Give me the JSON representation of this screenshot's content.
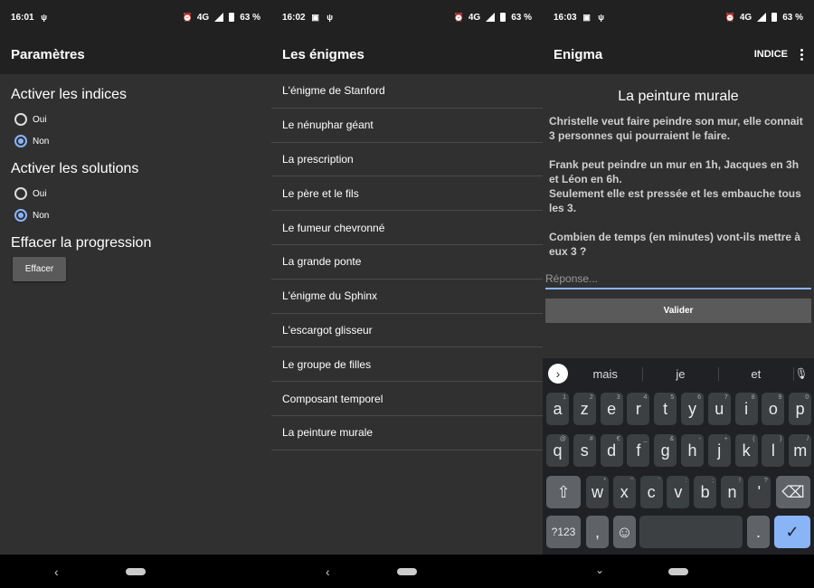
{
  "screens": [
    {
      "status": {
        "time": "16:01",
        "battery": "63 %",
        "network": "4G"
      },
      "appbar_title": "Paramètres",
      "hints": {
        "title": "Activer les indices",
        "yes": "Oui",
        "no": "Non",
        "selected": "Non"
      },
      "solutions": {
        "title": "Activer les solutions",
        "yes": "Oui",
        "no": "Non",
        "selected": "Non"
      },
      "reset": {
        "title": "Effacer la progression",
        "button": "Effacer"
      }
    },
    {
      "status": {
        "time": "16:02",
        "battery": "63 %",
        "network": "4G"
      },
      "appbar_title": "Les énigmes",
      "riddles": [
        "L'énigme de Stanford",
        "Le nénuphar géant",
        "La prescription",
        "Le père et le fils",
        "Le fumeur chevronné",
        "La grande ponte",
        "L'énigme du Sphinx",
        "L'escargot glisseur",
        "Le groupe de filles",
        "Composant temporel",
        "La peinture murale"
      ]
    },
    {
      "status": {
        "time": "16:03",
        "battery": "63 %",
        "network": "4G"
      },
      "appbar_title": "Enigma",
      "hint_action": "INDICE",
      "puzzle_title": "La peinture murale",
      "paragraphs": [
        "Christelle veut faire peindre son mur, elle connait 3 personnes qui pourraient le faire.",
        "Frank peut peindre un mur en 1h, Jacques en 3h et Léon en 6h.\nSeulement elle est pressée et les embauche tous les 3.",
        "Combien de temps (en minutes) vont-ils mettre à eux 3 ?"
      ],
      "answer_placeholder": "Réponse...",
      "validate_label": "Valider",
      "keyboard": {
        "suggestions": [
          "mais",
          "je",
          "et"
        ],
        "row1": [
          [
            "a",
            "1"
          ],
          [
            "z",
            "2"
          ],
          [
            "e",
            "3"
          ],
          [
            "r",
            "4"
          ],
          [
            "t",
            "5"
          ],
          [
            "y",
            "6"
          ],
          [
            "u",
            "7"
          ],
          [
            "i",
            "8"
          ],
          [
            "o",
            "9"
          ],
          [
            "p",
            "0"
          ]
        ],
        "row2": [
          [
            "q",
            "@"
          ],
          [
            "s",
            "#"
          ],
          [
            "d",
            "€"
          ],
          [
            "f",
            "_"
          ],
          [
            "g",
            "&"
          ],
          [
            "h",
            "-"
          ],
          [
            "j",
            "+"
          ],
          [
            "k",
            "("
          ],
          [
            "l",
            ")"
          ],
          [
            "m",
            "/"
          ]
        ],
        "row3": [
          [
            "w",
            "*"
          ],
          [
            "x",
            "\""
          ],
          [
            "c",
            "'"
          ],
          [
            "v",
            ":"
          ],
          [
            "b",
            ";"
          ],
          [
            "n",
            "!"
          ],
          [
            "'",
            "?"
          ]
        ],
        "sym_label": "?123",
        "comma": ",",
        "period": "."
      }
    }
  ],
  "colors": {
    "accent": "#8ab4f8",
    "background": "#303030",
    "appbar": "#212121"
  }
}
